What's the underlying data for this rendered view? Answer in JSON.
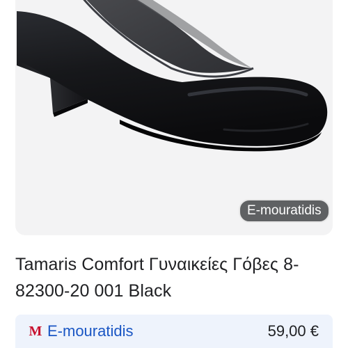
{
  "product": {
    "image_alt": "Tamaris Comfort Γυναικείες Γόβες 8-82300-20 001 Black",
    "store_chip": "E-mouratidis",
    "title": "Tamaris Comfort Γυναικείες Γόβες 8-82300-20 001 Black"
  },
  "offer": {
    "seller_logo_icon": "seller-m-logo-icon",
    "seller_logo_letter": "M",
    "seller_name": "E-mouratidis",
    "price": "59,00 €"
  },
  "colors": {
    "card_background": "#f3f3f4",
    "chip_background": "#5f6163",
    "offer_background": "#eef3fc",
    "seller_link": "#1a56c4",
    "logo_red": "#c8102e"
  }
}
